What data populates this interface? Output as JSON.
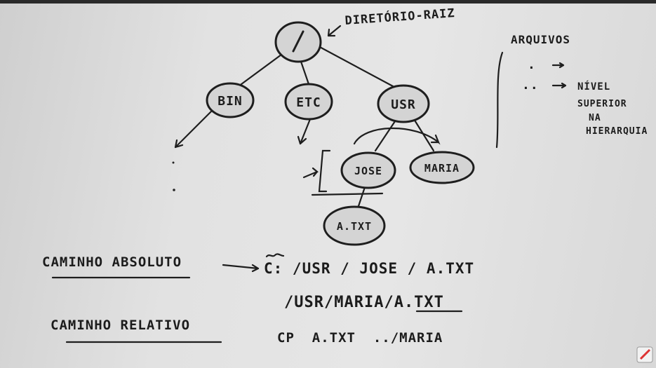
{
  "tree": {
    "root": {
      "label": "/",
      "annotation": "DIRETÓRIO-RAIZ"
    },
    "children": [
      "BIN",
      "ETC",
      "USR"
    ],
    "usr_children": [
      "JOSE",
      "MARIA"
    ],
    "jose_children": [
      "A.TXT"
    ]
  },
  "legend": {
    "title": "ARQUIVOS",
    "dot": ".",
    "dotdot": "..",
    "dotdot_meaning": [
      "NÍVEL",
      "SUPERIOR",
      "NA",
      "HIERARQUIA"
    ]
  },
  "paths": {
    "absolute_label": "CAMINHO ABSOLUTO",
    "absolute_example_1": "C: /USR / JOSE / A.TXT",
    "absolute_example_2": "/USR/MARIA/A.TXT",
    "relative_label": "CAMINHO RELATIVO",
    "relative_example": "CP  A.TXT  ../MARIA"
  }
}
